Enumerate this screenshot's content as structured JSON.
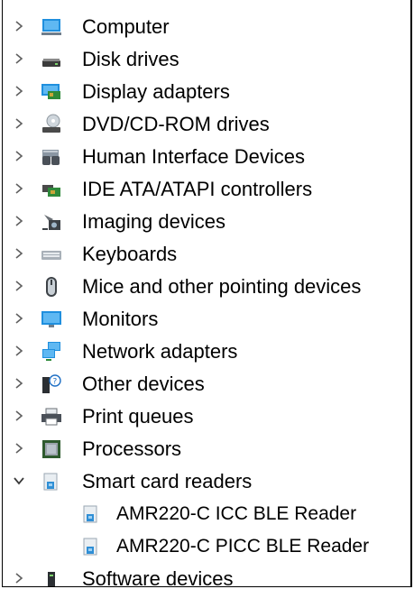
{
  "tree": {
    "items": [
      {
        "label": "Computer",
        "icon": "computer-icon",
        "expanded": false
      },
      {
        "label": "Disk drives",
        "icon": "disk-drive-icon",
        "expanded": false
      },
      {
        "label": "Display adapters",
        "icon": "display-adapter-icon",
        "expanded": false
      },
      {
        "label": "DVD/CD-ROM drives",
        "icon": "dvd-drive-icon",
        "expanded": false
      },
      {
        "label": "Human Interface Devices",
        "icon": "hid-icon",
        "expanded": false
      },
      {
        "label": "IDE ATA/ATAPI controllers",
        "icon": "ide-controller-icon",
        "expanded": false
      },
      {
        "label": "Imaging devices",
        "icon": "camera-icon",
        "expanded": false
      },
      {
        "label": "Keyboards",
        "icon": "keyboard-icon",
        "expanded": false
      },
      {
        "label": "Mice and other pointing devices",
        "icon": "mouse-icon",
        "expanded": false
      },
      {
        "label": "Monitors",
        "icon": "monitor-icon",
        "expanded": false
      },
      {
        "label": "Network adapters",
        "icon": "network-icon",
        "expanded": false
      },
      {
        "label": "Other devices",
        "icon": "unknown-device-icon",
        "expanded": false
      },
      {
        "label": "Print queues",
        "icon": "printer-icon",
        "expanded": false
      },
      {
        "label": "Processors",
        "icon": "processor-icon",
        "expanded": false
      },
      {
        "label": "Smart card readers",
        "icon": "smart-card-reader-icon",
        "expanded": true,
        "children": [
          {
            "label": "AMR220-C ICC BLE Reader",
            "icon": "smart-card-reader-icon"
          },
          {
            "label": "AMR220-C PICC BLE Reader",
            "icon": "smart-card-reader-icon"
          }
        ]
      },
      {
        "label": "Software devices",
        "icon": "software-device-icon",
        "expanded": false
      }
    ]
  },
  "colors": {
    "chevron": "#5f5f5f",
    "hover": "#e5f3ff",
    "accent": "#1e90d6"
  }
}
